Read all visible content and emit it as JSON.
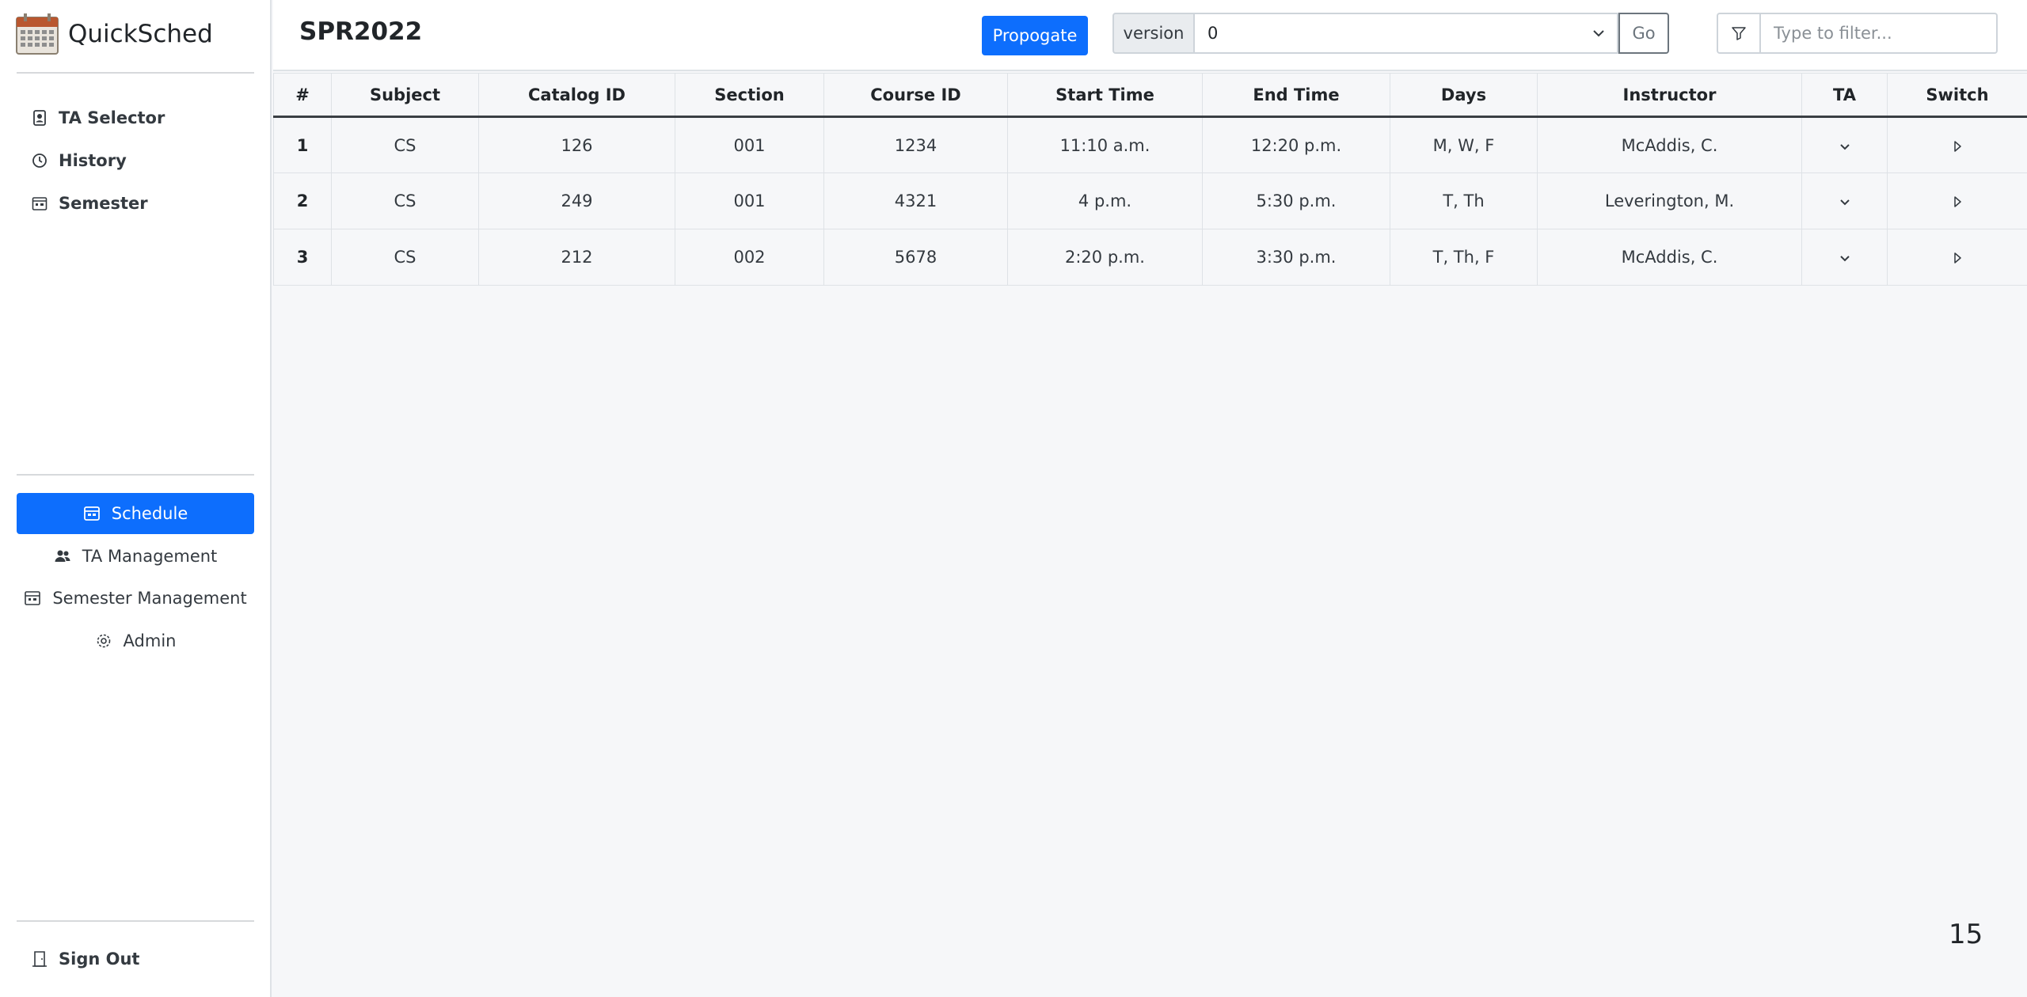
{
  "app": {
    "name": "QuickSched"
  },
  "sidebar": {
    "top_items": [
      {
        "label": "TA Selector",
        "icon": "person-badge-icon"
      },
      {
        "label": "History",
        "icon": "clock-icon"
      },
      {
        "label": "Semester",
        "icon": "calendar-icon"
      }
    ],
    "mid_items": [
      {
        "label": "Schedule",
        "icon": "calendar-week-icon",
        "active": true
      },
      {
        "label": "TA Management",
        "icon": "people-icon"
      },
      {
        "label": "Semester Management",
        "icon": "calendar-icon"
      },
      {
        "label": "Admin",
        "icon": "gear-icon"
      }
    ],
    "signout": {
      "label": "Sign Out",
      "icon": "door-icon"
    }
  },
  "header": {
    "title": "SPR2022",
    "propagate_label": "Propogate",
    "version_label": "version",
    "version_value": "0",
    "go_label": "Go",
    "filter_placeholder": "Type to filter..."
  },
  "table": {
    "columns": [
      "#",
      "Subject",
      "Catalog ID",
      "Section",
      "Course ID",
      "Start Time",
      "End Time",
      "Days",
      "Instructor",
      "TA",
      "Switch"
    ],
    "rows": [
      {
        "num": "1",
        "subject": "CS",
        "catalog": "126",
        "section": "001",
        "course": "1234",
        "start": "11:10 a.m.",
        "end": "12:20 p.m.",
        "days": "M, W, F",
        "instructor": "McAddis, C."
      },
      {
        "num": "2",
        "subject": "CS",
        "catalog": "249",
        "section": "001",
        "course": "4321",
        "start": "4 p.m.",
        "end": "5:30 p.m.",
        "days": "T, Th",
        "instructor": "Leverington, M."
      },
      {
        "num": "3",
        "subject": "CS",
        "catalog": "212",
        "section": "002",
        "course": "5678",
        "start": "2:20 p.m.",
        "end": "3:30 p.m.",
        "days": "T, Th, F",
        "instructor": "McAddis, C."
      }
    ]
  },
  "page_count": "15",
  "colors": {
    "primary": "#0d6efd",
    "background": "#f6f7f9",
    "sidebar": "#ffffff"
  }
}
